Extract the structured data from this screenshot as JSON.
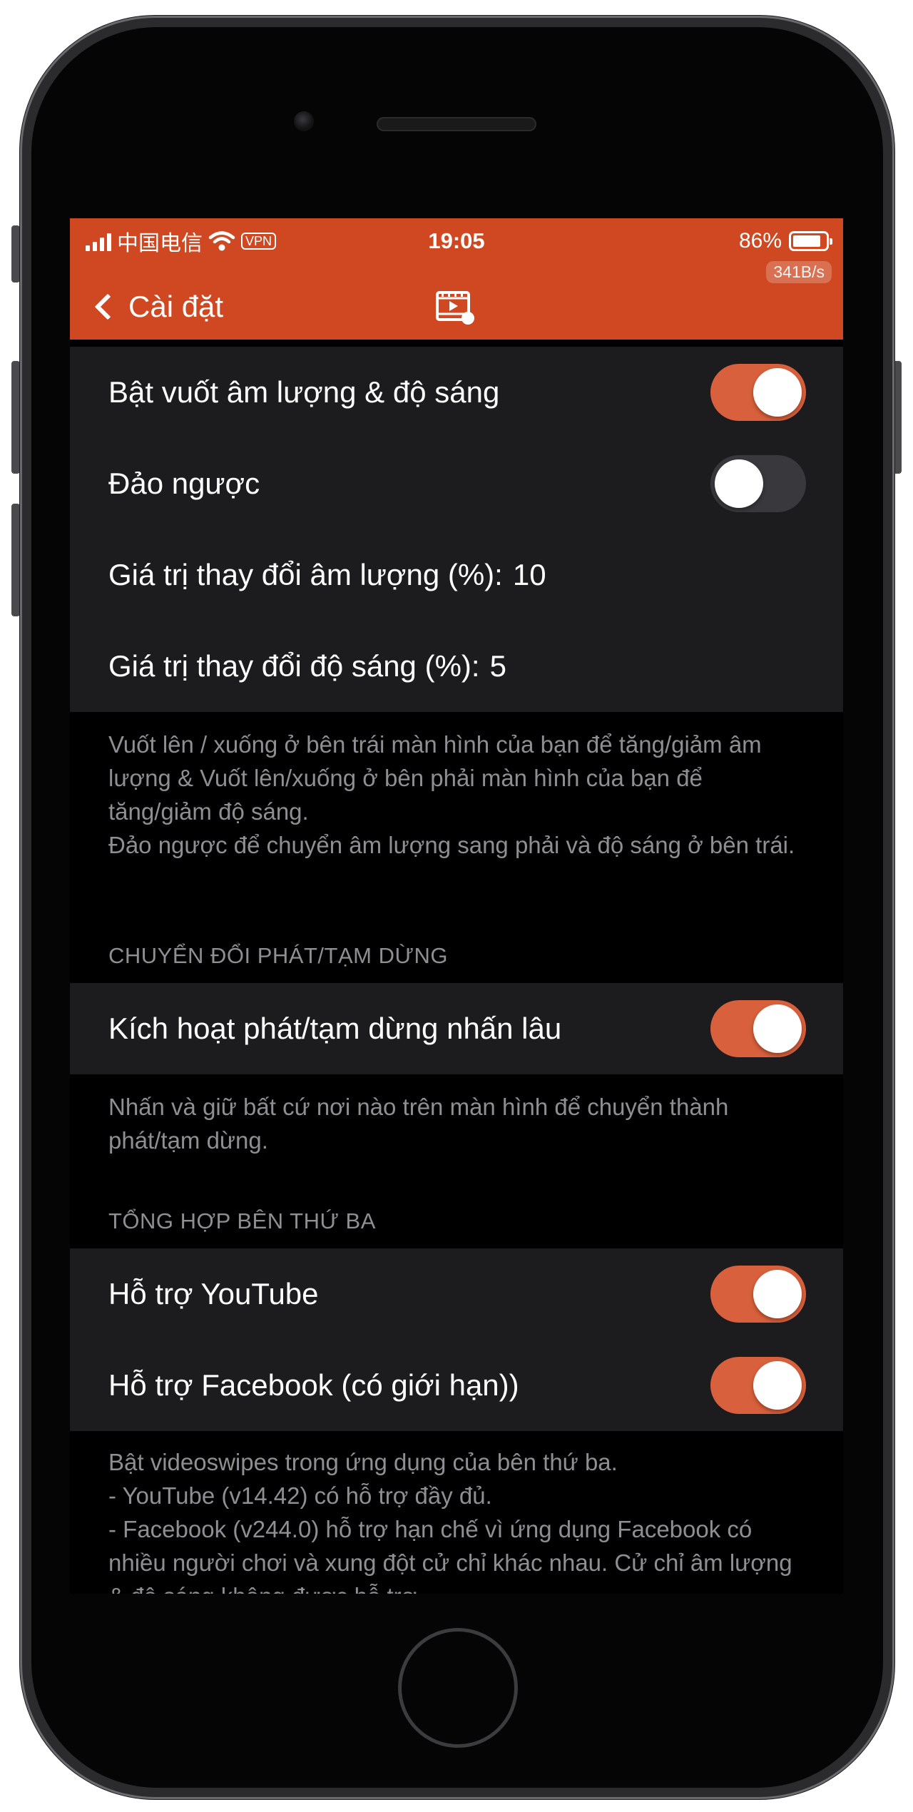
{
  "status_bar": {
    "carrier": "中国电信",
    "vpn": "VPN",
    "time": "19:05",
    "battery": "86%",
    "battery_level": 0.86,
    "net_speed": "341B/s"
  },
  "nav": {
    "back_label": "Cài đặt",
    "center_icon": "video-swipe-icon"
  },
  "colors": {
    "accent": "#cf4821",
    "toggle_on": "#d9603c",
    "toggle_off": "#39393d",
    "group_bg": "#1c1c1e",
    "footer_text": "#8e8e93"
  },
  "swipe_group": {
    "enable_label": "Bật vuốt âm lượng & độ sáng",
    "enable_on": true,
    "invert_label": "Đảo ngược",
    "invert_on": false,
    "volume_step_label": "Giá trị thay đổi âm lượng (%):",
    "volume_step_value": "10",
    "brightness_step_label": "Giá trị thay đổi độ sáng (%):",
    "brightness_step_value": "5",
    "footer_line1": "Vuốt lên / xuống ở bên trái màn hình của bạn để tăng/giảm âm lượng & Vuốt lên/xuống ở bên phải màn hình của bạn để tăng/giảm độ sáng.",
    "footer_line2": "Đảo ngược để chuyển âm lượng sang phải và độ sáng ở bên trái."
  },
  "playpause_group": {
    "header": "CHUYỂN ĐỔI PHÁT/TẠM DỪNG",
    "long_press_label": "Kích hoạt phát/tạm dừng nhấn lâu",
    "long_press_on": true,
    "footer": "Nhấn và giữ bất cứ nơi nào trên màn hình để chuyển thành phát/tạm dừng."
  },
  "third_party_group": {
    "header": "TỔNG HỢP BÊN THỨ BA",
    "youtube_label": "Hỗ trợ YouTube",
    "youtube_on": true,
    "facebook_label": "Hỗ trợ Facebook (có giới hạn))",
    "facebook_on": true,
    "footer_line1": "Bật videoswipes trong ứng dụng của bên thứ ba.",
    "footer_line2": "- YouTube (v14.42) có hỗ trợ đầy đủ.",
    "footer_line3": "- Facebook (v244.0) hỗ trợ hạn chế vì ứng dụng Facebook có nhiều người chơi và xung đột cử chỉ khác nhau. Cử chỉ âm lượng & độ sáng không được hỗ trợ."
  }
}
